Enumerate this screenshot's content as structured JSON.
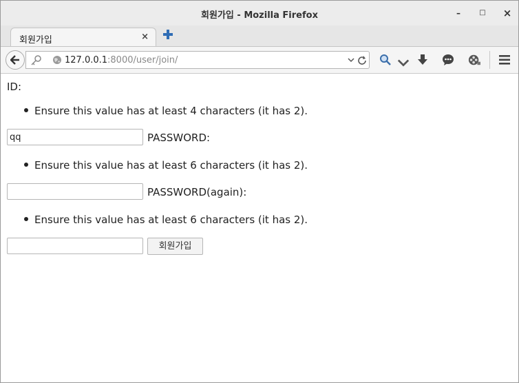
{
  "window": {
    "title": "회원가입 - Mozilla Firefox",
    "minimize_label": "–",
    "maximize_label": "□",
    "close_label": "×"
  },
  "tab": {
    "label": "회원가입",
    "close_label": "×"
  },
  "nav": {
    "url_host": "127.0.0.1",
    "url_rest": ":8000/user/join/"
  },
  "form": {
    "id_label": "ID:",
    "id_error": "Ensure this value has at least 4 characters (it has 2).",
    "id_value": "qq",
    "password_label": "PASSWORD:",
    "password_error": "Ensure this value has at least 6 characters (it has 2).",
    "password_value": "",
    "password_again_label": "PASSWORD(again):",
    "password_again_error": "Ensure this value has at least 6 characters (it has 2).",
    "password_again_value": "",
    "submit_label": "회원가입"
  },
  "colors": {
    "accent": "#2f6db5",
    "titlebar_bg": "#ececec"
  },
  "icons": [
    "back-icon",
    "identity-icon",
    "globe-icon",
    "dropdown-icon",
    "reload-icon",
    "search-icon",
    "download-icon",
    "chat-icon",
    "addon-icon",
    "menu-icon",
    "new-tab-icon"
  ]
}
